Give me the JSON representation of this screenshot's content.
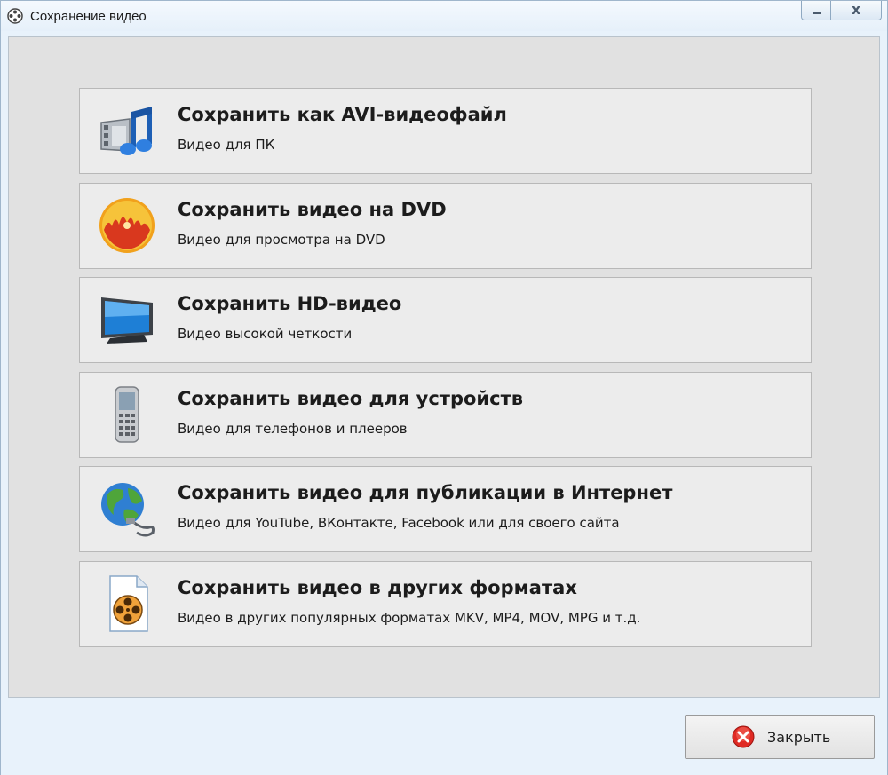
{
  "window": {
    "title": "Сохранение видео",
    "close_glyph": "x"
  },
  "options": [
    {
      "title": "Сохранить как AVI-видеофайл",
      "subtitle": "Видео для ПК",
      "icon": "avi-film-music-icon"
    },
    {
      "title": "Сохранить видео на DVD",
      "subtitle": "Видео для просмотра на DVD",
      "icon": "dvd-disc-icon"
    },
    {
      "title": "Сохранить HD-видео",
      "subtitle": "Видео высокой четкости",
      "icon": "hd-monitor-icon"
    },
    {
      "title": "Сохранить видео для устройств",
      "subtitle": "Видео для телефонов и плееров",
      "icon": "mobile-phone-icon"
    },
    {
      "title": "Сохранить видео для публикации в Интернет",
      "subtitle": "Видео для YouTube, ВКонтакте, Facebook или для своего сайта",
      "icon": "globe-icon"
    },
    {
      "title": "Сохранить видео в других форматах",
      "subtitle": "Видео в других популярных форматах MKV, MP4, MOV, MPG и т.д.",
      "icon": "film-reel-file-icon"
    }
  ],
  "footer": {
    "close_label": "Закрыть",
    "close_icon": "red-x-icon"
  },
  "colors": {
    "dialog_bg": "#e1e1e1",
    "option_bg": "#ececec",
    "frame": "#e8f2fb"
  }
}
